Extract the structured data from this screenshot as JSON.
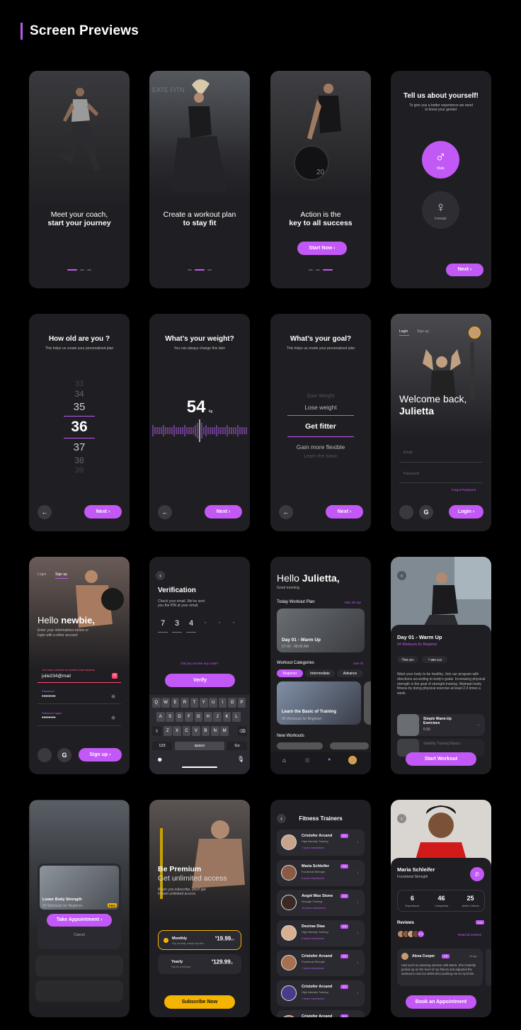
{
  "page": {
    "title": "Screen Previews"
  },
  "colors": {
    "accent": "#c258f5",
    "background": "#000000",
    "screen": "#1f1e22",
    "gold": "#f5b400"
  },
  "s1": {
    "line1": "Meet your coach,",
    "line2": "start your journey"
  },
  "s2": {
    "line1": "Create a workout plan",
    "line2": "to stay fit"
  },
  "s3": {
    "line1": "Action is the",
    "line2": "key to all success",
    "button": "Start Now"
  },
  "s4": {
    "title": "Tell us about yourself!",
    "subtitle1": "To give you a better experience we need",
    "subtitle2": "to know your gender",
    "male": "Male",
    "female": "Female",
    "button": "Next"
  },
  "s5": {
    "title": "How old are you ?",
    "subtitle": "This helps us create your personalized plan",
    "ages": [
      "33",
      "34",
      "35",
      "36",
      "37",
      "38",
      "39"
    ],
    "button": "Next"
  },
  "s6": {
    "title": "What’s your weight?",
    "subtitle": "You can always change this later",
    "value": "54",
    "unit": "kg",
    "button": "Next"
  },
  "s7": {
    "title": "What’s your goal?",
    "subtitle": "This helps us create your personalized plan",
    "goals": [
      "Gain Weight",
      "Lose weight",
      "Get fitter",
      "Gain more flexible",
      "Learn the basic"
    ],
    "button": "Next"
  },
  "s8": {
    "tab_login": "Login",
    "tab_signup": "Sign up",
    "line1": "Welcome back,",
    "line2": "Julietta",
    "email": "Email",
    "password": "Password",
    "forgot": "Forgot Password",
    "button": "Login"
  },
  "s9": {
    "tab_login": "Login",
    "tab_signup": "Sign up",
    "hello": "Hello",
    "name": "newbie,",
    "desc1": "Enter your informations below or",
    "desc2": "login with a other account",
    "error": "You have entered an invalid email address",
    "email_value": "julie234@mail",
    "password_label": "Password",
    "password_value": "••••••••",
    "password_again_label": "Password again",
    "password_again_value": "••••••••",
    "button": "Sign up"
  },
  "s10": {
    "title": "Verification",
    "desc1": "Check your email. We’ve sent",
    "desc2": "you the PIN at your email.",
    "pin": [
      "7",
      "3",
      "4",
      "•",
      "•",
      "•"
    ],
    "resend": "Did you receive any code?",
    "button": "Verify",
    "rows": [
      [
        "Q",
        "W",
        "E",
        "R",
        "T",
        "Y",
        "U",
        "I",
        "O",
        "P"
      ],
      [
        "A",
        "S",
        "D",
        "F",
        "G",
        "H",
        "J",
        "K",
        "L"
      ],
      [
        "Z",
        "X",
        "C",
        "V",
        "B",
        "N",
        "M"
      ]
    ],
    "key_123": "123",
    "key_space": "space",
    "key_go": "Go"
  },
  "s11": {
    "hello": "Hello",
    "name": "Julietta,",
    "greet": "Good morning.",
    "plan_label": "Today Workout Plan",
    "plan_date": "Mon 26 Apr",
    "plan_title": "Day 01 - Warm Up",
    "plan_time": "07:00 - 08:00 AM",
    "categories_label": "Workout Categories",
    "see_all": "See All",
    "tabs": [
      "Beginner",
      "Intermediate",
      "Advance"
    ],
    "card_title": "Learn the Basic of Training",
    "card_sub": "06 Workouts for Beginner",
    "new_label": "New Workouts"
  },
  "s12": {
    "title": "Day 01 - Warm Up",
    "sub": "04 Workouts for Beginner",
    "time": "60 min",
    "cal": "350 Cal",
    "desc": "Want your body to be healthy. Join our program with directions according to body’s goals. Increasing physical strength is the goal of strenght training. Maintain body fitness by doing physical exercise at least 2-3 times a week.",
    "item1_title": "Simple Warm-Up Exercises",
    "item1_time": "0:30",
    "item2_title": "Stability Training Basics",
    "button": "Start Workout"
  },
  "s13": {
    "card_title": "Lower Body Strength",
    "card_sub": "05 Workouts for Beginner",
    "badge": "PRO",
    "button": "Take Appointment",
    "cancel": "Cancel"
  },
  "s14": {
    "title": "Be Premium",
    "sub": "Get unlimited access",
    "desc1": "When you subscribe, you’ll get",
    "desc2": "instant unlimited access",
    "plan1": "Monthly",
    "plan1_note": "Pay monthly, cancel any time",
    "plan1_price": "19.99",
    "plan1_per": "/m",
    "plan2": "Yearly",
    "plan2_note": "Pay for a full year",
    "plan2_price": "129.99",
    "plan2_per": "/y",
    "currency": "$",
    "button": "Subscribe Now"
  },
  "s15": {
    "title": "Fitness Trainers",
    "trainers": [
      {
        "name": "Cristofer Arcand",
        "rating": "4.4",
        "specialty": "High Intensity Training",
        "exp": "7 years experience"
      },
      {
        "name": "Maria Schleifer",
        "rating": "4.6",
        "specialty": "Functional Strength",
        "exp": "6 years experience"
      },
      {
        "name": "Angel Max Stone",
        "rating": "4.5",
        "specialty": "Strength Training",
        "exp": "10 years experience"
      },
      {
        "name": "Desirae Dias",
        "rating": "4.8",
        "specialty": "High Intensity Training",
        "exp": "5 years experience"
      },
      {
        "name": "Cristofer Arcand",
        "rating": "4.8",
        "specialty": "Functional Strength",
        "exp": "7 years experience"
      },
      {
        "name": "Cristofer Arcand",
        "rating": "4.2",
        "specialty": "High Intensity Training",
        "exp": "7 years experience"
      },
      {
        "name": "Cristofer Arcand",
        "rating": "4.4",
        "specialty": "",
        "exp": ""
      }
    ]
  },
  "s16": {
    "name": "Maria Schleifer",
    "specialty": "Functional Strength",
    "stats": [
      {
        "value": "6",
        "label": "Experience"
      },
      {
        "value": "46",
        "label": "Completed"
      },
      {
        "value": "25",
        "label": "Active Clients"
      }
    ],
    "reviews_label": "Reviews",
    "reviews_rating": "4.6",
    "read_all": "Read all reviews",
    "reviewer_count": "174",
    "reviewer": "Alexa Cooper",
    "reviewer_rating": "4.9",
    "review_time": "2d ago",
    "review_text": "Had such an amazing session with Maria. She instantly picked up on the level of my fitness and adjusted the workout to suit me whilst also pushing me to my limits.",
    "button": "Book an Appointment"
  }
}
